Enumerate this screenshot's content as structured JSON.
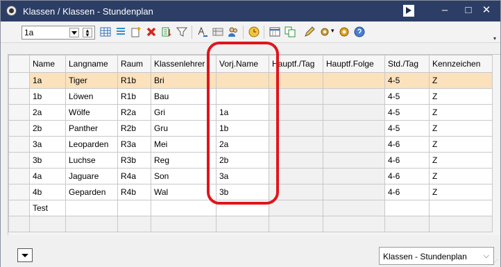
{
  "window": {
    "title": "Klassen / Klassen - Stundenplan",
    "controls": {
      "minimize": "–",
      "maximize": "□",
      "close": "✕"
    }
  },
  "toolbar": {
    "class_selector_value": "1a"
  },
  "grid": {
    "columns": [
      "Name",
      "Langname",
      "Raum",
      "Klassenlehrer",
      "Vorj.Name",
      "Hauptf./Tag",
      "Hauptf.Folge",
      "Std./Tag",
      "Kennzeichen"
    ],
    "rows": [
      {
        "name": "1a",
        "langname": "Tiger",
        "raum": "R1b",
        "klassenlehrer": "Bri",
        "vorj": "",
        "hauptf_tag": "",
        "hauptf_folge": "",
        "std_tag": "4-5",
        "kennzeichen": "Z"
      },
      {
        "name": "1b",
        "langname": "Löwen",
        "raum": "R1b",
        "klassenlehrer": "Bau",
        "vorj": "",
        "hauptf_tag": "",
        "hauptf_folge": "",
        "std_tag": "4-5",
        "kennzeichen": "Z"
      },
      {
        "name": "2a",
        "langname": "Wölfe",
        "raum": "R2a",
        "klassenlehrer": "Gri",
        "vorj": "1a",
        "hauptf_tag": "",
        "hauptf_folge": "",
        "std_tag": "4-5",
        "kennzeichen": "Z"
      },
      {
        "name": "2b",
        "langname": "Panther",
        "raum": "R2b",
        "klassenlehrer": "Gru",
        "vorj": "1b",
        "hauptf_tag": "",
        "hauptf_folge": "",
        "std_tag": "4-5",
        "kennzeichen": "Z"
      },
      {
        "name": "3a",
        "langname": "Leoparden",
        "raum": "R3a",
        "klassenlehrer": "Mei",
        "vorj": "2a",
        "hauptf_tag": "",
        "hauptf_folge": "",
        "std_tag": "4-6",
        "kennzeichen": "Z"
      },
      {
        "name": "3b",
        "langname": "Luchse",
        "raum": "R3b",
        "klassenlehrer": "Reg",
        "vorj": "2b",
        "hauptf_tag": "",
        "hauptf_folge": "",
        "std_tag": "4-6",
        "kennzeichen": "Z"
      },
      {
        "name": "4a",
        "langname": "Jaguare",
        "raum": "R4a",
        "klassenlehrer": "Son",
        "vorj": "3a",
        "hauptf_tag": "",
        "hauptf_folge": "",
        "std_tag": "4-6",
        "kennzeichen": "Z"
      },
      {
        "name": "4b",
        "langname": "Geparden",
        "raum": "R4b",
        "klassenlehrer": "Wal",
        "vorj": "3b",
        "hauptf_tag": "",
        "hauptf_folge": "",
        "std_tag": "4-6",
        "kennzeichen": "Z"
      },
      {
        "name": "Test",
        "langname": "",
        "raum": "",
        "klassenlehrer": "",
        "vorj": "",
        "hauptf_tag": "",
        "hauptf_folge": "",
        "std_tag": "",
        "kennzeichen": ""
      }
    ]
  },
  "footer": {
    "view_selector_value": "Klassen - Stundenplan"
  },
  "colors": {
    "titlebar": "#2c3e66",
    "selected_row": "#fbe1bc",
    "highlight_box": "#e0151b"
  }
}
